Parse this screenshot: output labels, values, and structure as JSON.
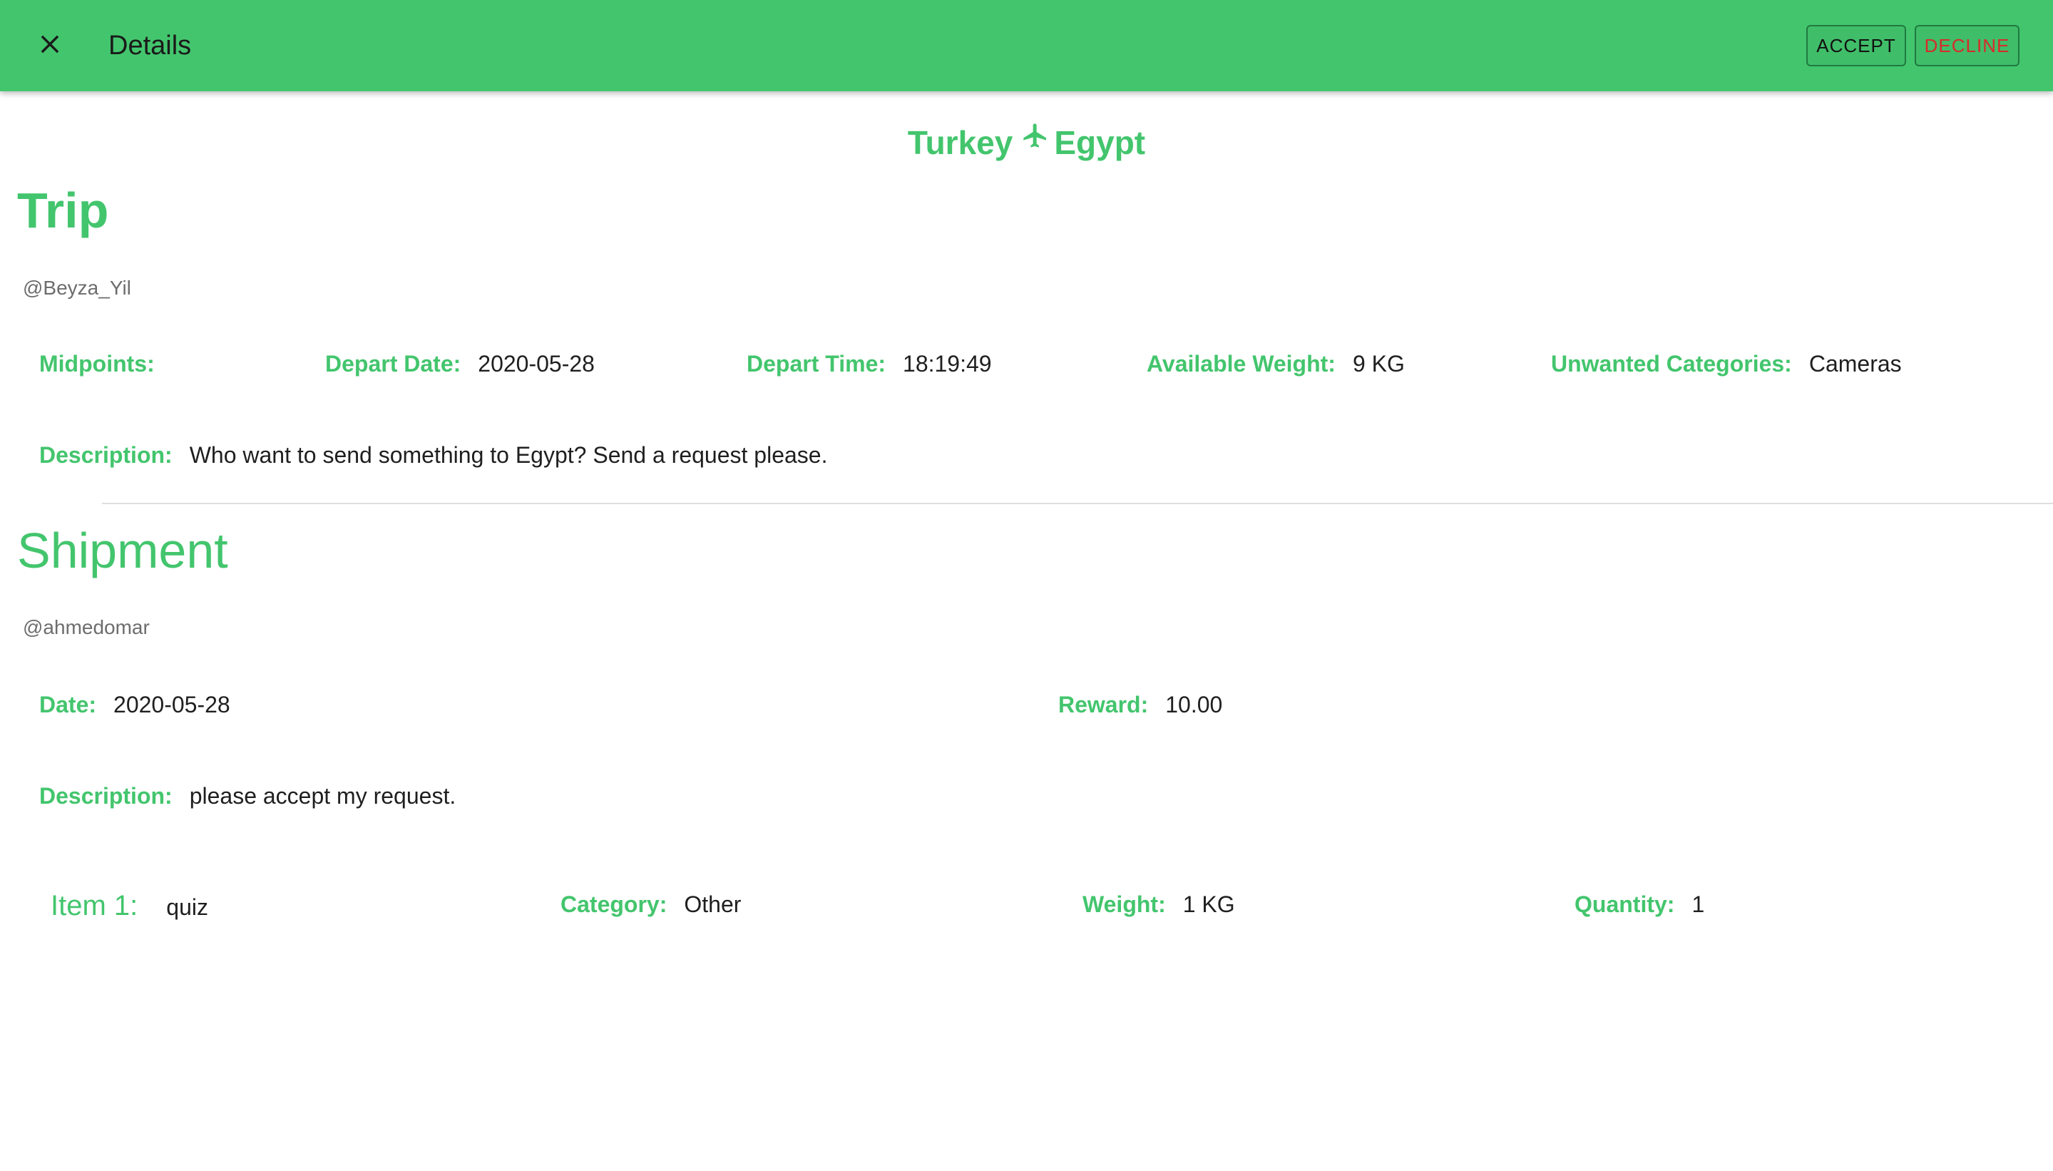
{
  "app_bar": {
    "title": "Details",
    "close_icon": "close-icon",
    "accept_label": "ACCEPT",
    "decline_label": "DECLINE",
    "bar_color": "#43c56d",
    "decline_color": "#d72b2b"
  },
  "route": {
    "origin": "Turkey",
    "destination": "Egypt",
    "icon": "airplane-icon"
  },
  "trip": {
    "title": "Trip",
    "username": "@Beyza_Yil",
    "midpoints_label": "Midpoints:",
    "midpoints_value": "",
    "depart_date_label": "Depart Date:",
    "depart_date_value": "2020-05-28",
    "depart_time_label": "Depart Time:",
    "depart_time_value": "18:19:49",
    "available_weight_label": "Available Weight:",
    "available_weight_value": "9 KG",
    "unwanted_categories_label": "Unwanted Categories:",
    "unwanted_categories_value": "Cameras",
    "description_label": "Description:",
    "description_value": "Who want to send something to Egypt? Send a request please."
  },
  "shipment": {
    "title": "Shipment",
    "username": "@ahmedomar",
    "date_label": "Date:",
    "date_value": "2020-05-28",
    "reward_label": "Reward:",
    "reward_value": "10.00",
    "description_label": "Description:",
    "description_value": "please accept my request.",
    "items": [
      {
        "label": "Item 1:",
        "name": "quiz",
        "category_label": "Category:",
        "category_value": "Other",
        "weight_label": "Weight:",
        "weight_value": "1 KG",
        "quantity_label": "Quantity:",
        "quantity_value": "1"
      }
    ]
  },
  "theme": {
    "accent": "#43c56d",
    "text": "#1f1f1f",
    "muted": "#6d6d6d"
  }
}
